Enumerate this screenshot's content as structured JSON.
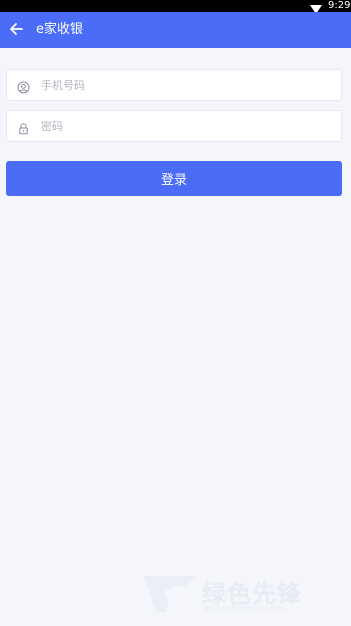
{
  "status_bar": {
    "time": "9:29",
    "wifi_icon": "wifi-icon"
  },
  "app_bar": {
    "back_icon": "arrow-left-icon",
    "title": "e家收银"
  },
  "login_form": {
    "phone": {
      "icon": "user-circle-icon",
      "placeholder": "手机号码",
      "value": ""
    },
    "password": {
      "icon": "lock-icon",
      "placeholder": "密码",
      "value": ""
    },
    "submit_label": "登录"
  },
  "watermark": {
    "text": "绿色先锋",
    "sub": "www.downcc.com"
  },
  "colors": {
    "primary": "#4a6cf7",
    "background": "#f4f6fb",
    "status_bar": "#000000",
    "input_border": "#e6e8ef",
    "placeholder": "#b3b6bf"
  }
}
